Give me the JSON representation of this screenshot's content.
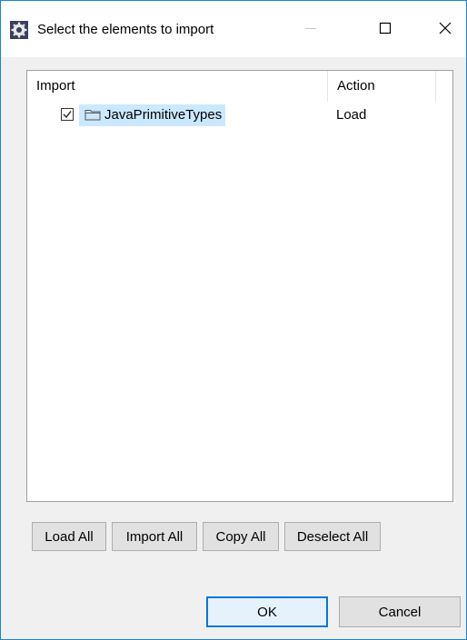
{
  "window": {
    "title": "Select the elements to import",
    "icons": {
      "app": "eclipse-gear-icon",
      "minimize": "minimize-icon",
      "maximize": "maximize-icon",
      "close": "close-icon"
    }
  },
  "tree": {
    "columns": [
      "Import",
      "Action"
    ],
    "rows": [
      {
        "label": "JavaPrimitiveTypes",
        "action": "Load",
        "checked": true,
        "icon": "folder-icon",
        "selected": true
      }
    ]
  },
  "buttons": {
    "load_all": "Load All",
    "import_all": "Import All",
    "copy_all": "Copy All",
    "deselect_all": "Deselect All",
    "ok": "OK",
    "cancel": "Cancel"
  },
  "colors": {
    "selection": "#cce8ff",
    "accent": "#0078d7",
    "window_border": "#1883d7"
  }
}
